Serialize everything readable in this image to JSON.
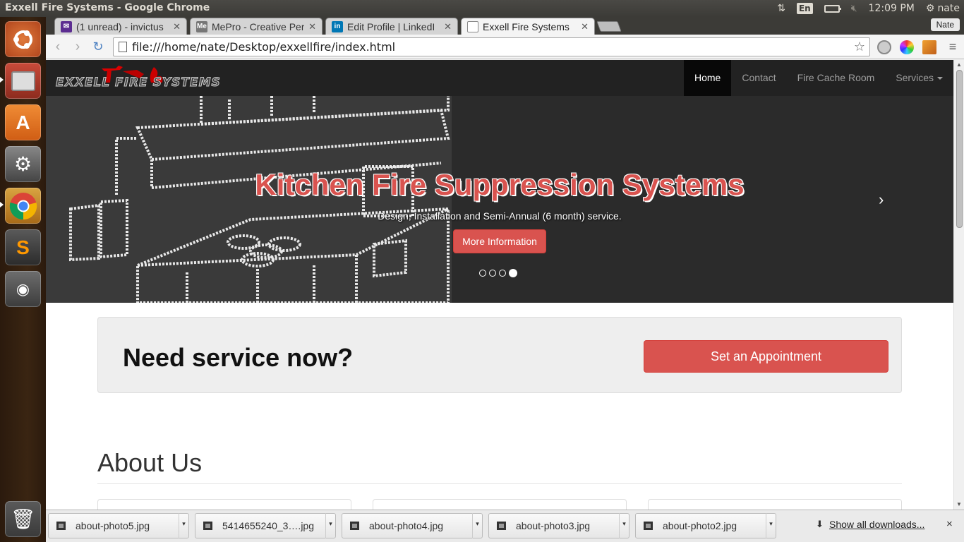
{
  "window": {
    "title": "Exxell Fire Systems - Google Chrome"
  },
  "tray": {
    "lang": "En",
    "time": "12:09 PM",
    "user": "nate"
  },
  "browser": {
    "profile": "Nate",
    "url": "file:///home/nate/Desktop/exxellfire/index.html",
    "tabs": [
      {
        "label": "(1 unread) - invictus",
        "icon": "mail-icon",
        "color": "#5c2d91"
      },
      {
        "label": "MePro - Creative Per",
        "icon": "mepro-icon",
        "color": "#777777"
      },
      {
        "label": "Edit Profile | LinkedI",
        "icon": "linkedin-icon",
        "color": "#0077b5"
      },
      {
        "label": "Exxell Fire Systems",
        "icon": "page-icon",
        "color": "#ffffff"
      }
    ]
  },
  "site": {
    "logo_text": "EXXELL FIRE SYSTEMS",
    "nav": {
      "home": "Home",
      "contact": "Contact",
      "fire_cache": "Fire Cache Room",
      "services": "Services"
    },
    "hero": {
      "title": "Kitchen Fire Suppression Systems",
      "subtitle": "Design, Installation and Semi-Annual (6 month) service.",
      "button": "More Information",
      "next": "›",
      "slide_count": 4,
      "active_slide": 4
    },
    "cta": {
      "heading": "Need service now?",
      "button": "Set an Appointment"
    },
    "about": {
      "title": "About Us"
    },
    "colors": {
      "accent": "#d9534f",
      "navbar": "#222222"
    }
  },
  "downloads": {
    "items": [
      {
        "name": "about-photo5.jpg"
      },
      {
        "name": "5414655240_3….jpg"
      },
      {
        "name": "about-photo4.jpg"
      },
      {
        "name": "about-photo3.jpg"
      },
      {
        "name": "about-photo2.jpg"
      }
    ],
    "show_all": "Show all downloads...",
    "close": "×"
  }
}
